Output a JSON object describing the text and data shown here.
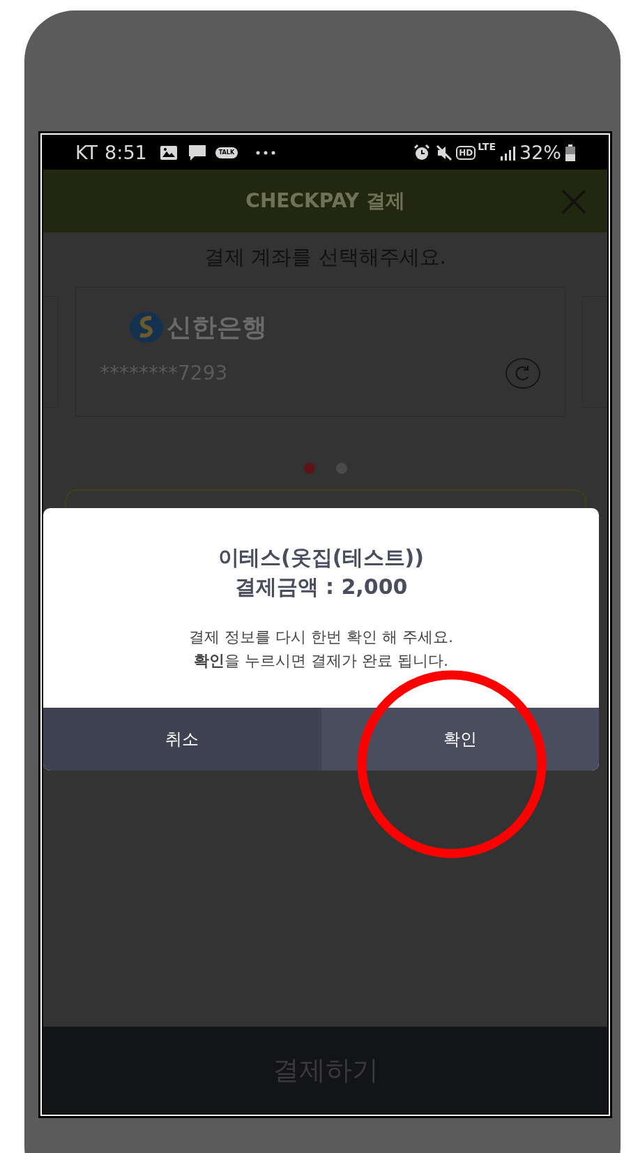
{
  "status_bar": {
    "carrier": "KT",
    "time": "8:51",
    "talk_label": "TALK",
    "hd_label": "HD",
    "network": "LTE",
    "battery": "32%"
  },
  "header": {
    "title": "CHECKPAY 결제"
  },
  "prompt": "결제 계좌를 선택해주세요.",
  "account_card": {
    "bank_name": "신한은행",
    "account_number": "********7293"
  },
  "pager_dots": [
    {
      "selected": true
    },
    {
      "selected": false
    }
  ],
  "dialog": {
    "title": "이테스(옷집(테스트))",
    "amount": "결제금액 : 2,000",
    "message_lines": [
      "결제 정보를 다시 한번 확인 해 주세요.",
      "**확인**을 누르시면 결제가 완료 됩니다."
    ],
    "buttons": [
      {
        "label": "취소",
        "primary": false
      },
      {
        "label": "확인",
        "primary": true
      }
    ]
  },
  "pay_button": {
    "label": "결제하기"
  }
}
